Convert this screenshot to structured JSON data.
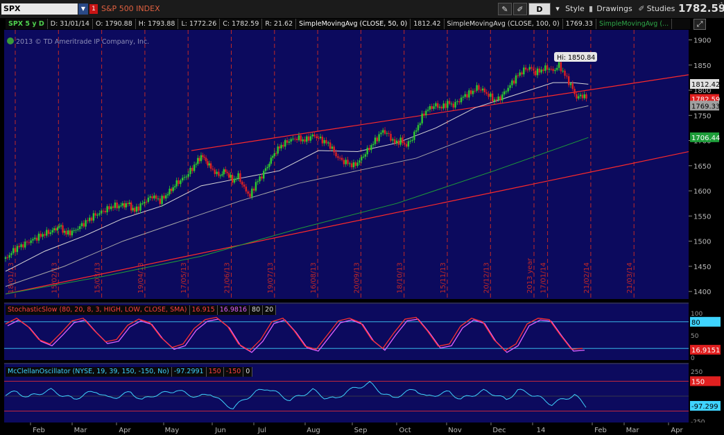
{
  "toolbar": {
    "symbol": "SPX",
    "flag": "1",
    "description": "S&P 500 INDEX",
    "chart_style_label": "D",
    "style_label": "Style",
    "drawings_label": "Drawings",
    "studies_label": "Studies",
    "last_price": "1782.59",
    "change_top": "-1",
    "change_bottom": "-0."
  },
  "header": {
    "period": "SPX 5 y D",
    "date": "D: 31/01/14",
    "open": "O: 1790.88",
    "high": "H: 1793.88",
    "low": "L: 1772.26",
    "close": "C: 1782.59",
    "range": "R: 21.62",
    "sma50_label": "SimpleMovingAvg (CLOSE, 50, 0)",
    "sma50_value": "1812.42",
    "sma100_label": "SimpleMovingAvg (CLOSE, 100, 0)",
    "sma100_value": "1769.33",
    "sma200_label": "SimpleMovingAvg (..."
  },
  "copyright": "2013 © TD Ameritrade IP Company, Inc.",
  "colors": {
    "chart_bg": "#0c0a5e",
    "grid_red": "#c02828",
    "up_candle": "#2ecc2e",
    "down_candle": "#e02020",
    "sma50": "#d8d8d8",
    "sma100": "#a8a8a8",
    "sma200": "#1e9e3a",
    "stoch_k": "#ff3030",
    "stoch_d": "#e060ff",
    "mcclellan": "#3fd4ff"
  },
  "chart_data": {
    "type": "candlestick",
    "price_axis": {
      "ticks": [
        "1900",
        "1850",
        "1800",
        "1750",
        "1700",
        "1650",
        "1600",
        "1550",
        "1500",
        "1450",
        "1400"
      ],
      "range": [
        1385,
        1920
      ]
    },
    "hi_label": "Hi: 1850.84",
    "price_labels": {
      "sma50": "1812.42",
      "last": "1782.59",
      "sma100": "1769.33",
      "sma200": "1706.44"
    },
    "vertical_dates": [
      "18/01/13",
      "15/02/13",
      "15/03/13",
      "19/04/13",
      "17/05/13",
      "21/06/13",
      "19/07/13",
      "16/08/13",
      "20/09/13",
      "18/10/13",
      "15/11/13",
      "20/12/13",
      "2013 year",
      "17/01/14",
      "21/02/14",
      "21/03/14"
    ],
    "month_labels": [
      "Feb",
      "Mar",
      "Apr",
      "May",
      "Jun",
      "Jul",
      "Aug",
      "Sep",
      "Oct",
      "Nov",
      "Dec",
      "14",
      "Feb",
      "Mar",
      "Apr"
    ],
    "close_path": [
      [
        0,
        1465
      ],
      [
        10,
        1485
      ],
      [
        20,
        1495
      ],
      [
        30,
        1505
      ],
      [
        40,
        1515
      ],
      [
        48,
        1520
      ],
      [
        55,
        1530
      ],
      [
        62,
        1515
      ],
      [
        70,
        1520
      ],
      [
        80,
        1535
      ],
      [
        90,
        1550
      ],
      [
        100,
        1560
      ],
      [
        110,
        1570
      ],
      [
        118,
        1570
      ],
      [
        125,
        1575
      ],
      [
        132,
        1560
      ],
      [
        140,
        1575
      ],
      [
        150,
        1590
      ],
      [
        158,
        1580
      ],
      [
        166,
        1595
      ],
      [
        175,
        1615
      ],
      [
        185,
        1630
      ],
      [
        195,
        1655
      ],
      [
        200,
        1670
      ],
      [
        205,
        1660
      ],
      [
        210,
        1645
      ],
      [
        218,
        1630
      ],
      [
        225,
        1640
      ],
      [
        232,
        1620
      ],
      [
        238,
        1630
      ],
      [
        244,
        1605
      ],
      [
        250,
        1590
      ],
      [
        256,
        1615
      ],
      [
        262,
        1630
      ],
      [
        268,
        1650
      ],
      [
        275,
        1675
      ],
      [
        282,
        1690
      ],
      [
        290,
        1700
      ],
      [
        298,
        1705
      ],
      [
        306,
        1700
      ],
      [
        314,
        1710
      ],
      [
        320,
        1705
      ],
      [
        326,
        1698
      ],
      [
        332,
        1690
      ],
      [
        338,
        1670
      ],
      [
        344,
        1660
      ],
      [
        350,
        1655
      ],
      [
        356,
        1650
      ],
      [
        362,
        1660
      ],
      [
        368,
        1675
      ],
      [
        374,
        1690
      ],
      [
        380,
        1705
      ],
      [
        386,
        1720
      ],
      [
        392,
        1710
      ],
      [
        398,
        1695
      ],
      [
        404,
        1700
      ],
      [
        410,
        1690
      ],
      [
        416,
        1705
      ],
      [
        422,
        1730
      ],
      [
        428,
        1755
      ],
      [
        434,
        1765
      ],
      [
        440,
        1770
      ],
      [
        446,
        1765
      ],
      [
        452,
        1775
      ],
      [
        458,
        1770
      ],
      [
        464,
        1780
      ],
      [
        470,
        1790
      ],
      [
        476,
        1795
      ],
      [
        482,
        1805
      ],
      [
        488,
        1800
      ],
      [
        494,
        1790
      ],
      [
        500,
        1780
      ],
      [
        506,
        1785
      ],
      [
        512,
        1800
      ],
      [
        518,
        1815
      ],
      [
        524,
        1830
      ],
      [
        530,
        1840
      ],
      [
        536,
        1845
      ],
      [
        542,
        1835
      ],
      [
        548,
        1840
      ],
      [
        554,
        1845
      ],
      [
        560,
        1838
      ],
      [
        566,
        1850
      ],
      [
        572,
        1830
      ],
      [
        578,
        1810
      ],
      [
        584,
        1785
      ],
      [
        590,
        1790
      ],
      [
        596,
        1782
      ]
    ],
    "sma50_path": [
      [
        0,
        1440
      ],
      [
        40,
        1480
      ],
      [
        80,
        1510
      ],
      [
        120,
        1545
      ],
      [
        160,
        1570
      ],
      [
        200,
        1610
      ],
      [
        240,
        1625
      ],
      [
        280,
        1640
      ],
      [
        320,
        1680
      ],
      [
        360,
        1678
      ],
      [
        400,
        1695
      ],
      [
        440,
        1725
      ],
      [
        480,
        1765
      ],
      [
        520,
        1790
      ],
      [
        560,
        1815
      ],
      [
        580,
        1815
      ],
      [
        596,
        1812
      ]
    ],
    "sma100_path": [
      [
        0,
        1410
      ],
      [
        60,
        1450
      ],
      [
        120,
        1500
      ],
      [
        180,
        1540
      ],
      [
        240,
        1580
      ],
      [
        300,
        1615
      ],
      [
        360,
        1640
      ],
      [
        420,
        1665
      ],
      [
        480,
        1710
      ],
      [
        540,
        1745
      ],
      [
        596,
        1769
      ]
    ],
    "sma200_path": [
      [
        0,
        1395
      ],
      [
        100,
        1430
      ],
      [
        200,
        1470
      ],
      [
        300,
        1525
      ],
      [
        400,
        1575
      ],
      [
        500,
        1640
      ],
      [
        596,
        1706
      ]
    ],
    "channel_upper": [
      [
        190,
        1680
      ],
      [
        1000,
        1920
      ]
    ],
    "channel_lower": [
      [
        0,
        1395
      ],
      [
        1000,
        1800
      ]
    ],
    "stochastic": {
      "label": "StochasticSlow (80, 20, 8, 3, HIGH, LOW, CLOSE, SMA)",
      "k_value": "16.915",
      "d_value": "16.9816",
      "overbought": "80",
      "oversold": "20",
      "axis_ticks": [
        "100",
        "50",
        "0"
      ],
      "right_labels": [
        "80",
        "16.9151"
      ],
      "k_path": [
        75,
        88,
        70,
        40,
        30,
        55,
        82,
        88,
        60,
        35,
        40,
        72,
        86,
        78,
        45,
        22,
        30,
        65,
        85,
        90,
        70,
        30,
        15,
        40,
        80,
        88,
        60,
        25,
        18,
        50,
        82,
        88,
        78,
        40,
        20,
        55,
        86,
        90,
        60,
        25,
        30,
        70,
        88,
        80,
        40,
        15,
        30,
        75,
        88,
        85,
        50,
        18,
        20
      ]
    },
    "mcclellan": {
      "label": "McClellanOscillator (NYSE, 19, 39, 150, -150, No)",
      "value": "-97.2991",
      "upper": "150",
      "lower": "-150",
      "zero": "0",
      "axis_ticks": [
        "250",
        "-250"
      ],
      "right_labels": [
        "150",
        "-97.299"
      ],
      "path": [
        20,
        40,
        -10,
        30,
        60,
        10,
        -30,
        20,
        50,
        -20,
        0,
        40,
        -40,
        10,
        30,
        60,
        20,
        -10,
        30,
        -60,
        -120,
        -30,
        40,
        80,
        20,
        -40,
        10,
        60,
        -10,
        -30,
        50,
        90,
        130,
        40,
        -20,
        30,
        70,
        -10,
        20,
        40,
        -30,
        10,
        50,
        20,
        -40,
        60,
        30,
        -20,
        -80,
        -30,
        10,
        -97
      ]
    }
  }
}
